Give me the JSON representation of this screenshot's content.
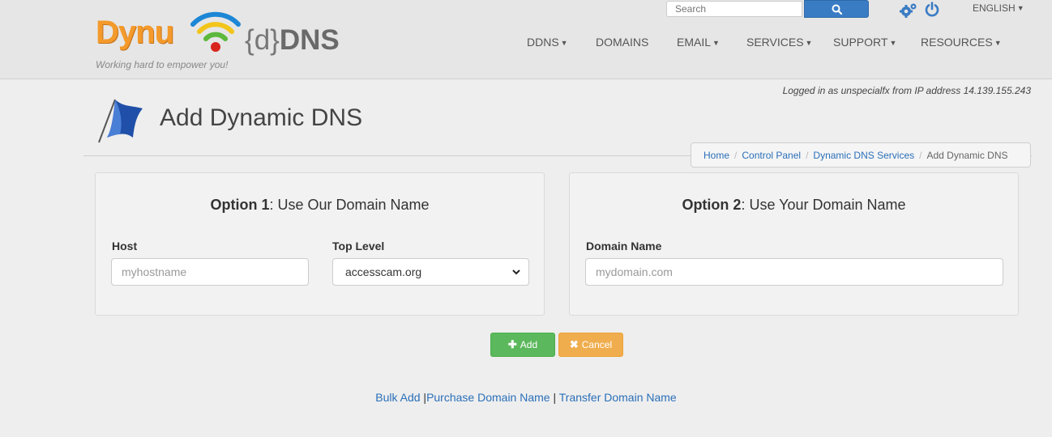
{
  "header": {
    "logo_text": "Dynu",
    "logo_ddns_curly": "{d}",
    "logo_ddns_bold": "DNS",
    "tagline": "Working hard to empower you!",
    "search_placeholder": "Search",
    "language": "ENGLISH"
  },
  "nav": {
    "items": [
      {
        "label": "DDNS",
        "dropdown": true
      },
      {
        "label": "DOMAINS",
        "dropdown": false
      },
      {
        "label": "EMAIL",
        "dropdown": true
      },
      {
        "label": "SERVICES",
        "dropdown": true
      },
      {
        "label": "SUPPORT",
        "dropdown": true
      },
      {
        "label": "RESOURCES",
        "dropdown": true
      }
    ]
  },
  "session": {
    "logged_in_text": "Logged in as unspecialfx from IP address 14.139.155.243"
  },
  "page": {
    "title": "Add Dynamic DNS"
  },
  "breadcrumb": {
    "items": [
      "Home",
      "Control Panel",
      "Dynamic DNS Services"
    ],
    "current": "Add Dynamic DNS"
  },
  "option1": {
    "heading_bold": "Option 1",
    "heading_rest": ": Use Our Domain Name",
    "host_label": "Host",
    "host_placeholder": "myhostname",
    "top_level_label": "Top Level",
    "top_level_value": "accesscam.org"
  },
  "option2": {
    "heading_bold": "Option 2",
    "heading_rest": ": Use Your Domain Name",
    "domain_label": "Domain Name",
    "domain_placeholder": "mydomain.com"
  },
  "actions": {
    "add_label": "Add",
    "cancel_label": "Cancel"
  },
  "links": {
    "bulk_add": "Bulk Add",
    "purchase": "Purchase Domain Name",
    "transfer": "Transfer Domain Name",
    "separator": "|"
  },
  "colors": {
    "accent_blue": "#3a7cc4",
    "add_green": "#5cb85c",
    "cancel_orange": "#f0ad4e",
    "logo_orange": "#f39a2b"
  }
}
